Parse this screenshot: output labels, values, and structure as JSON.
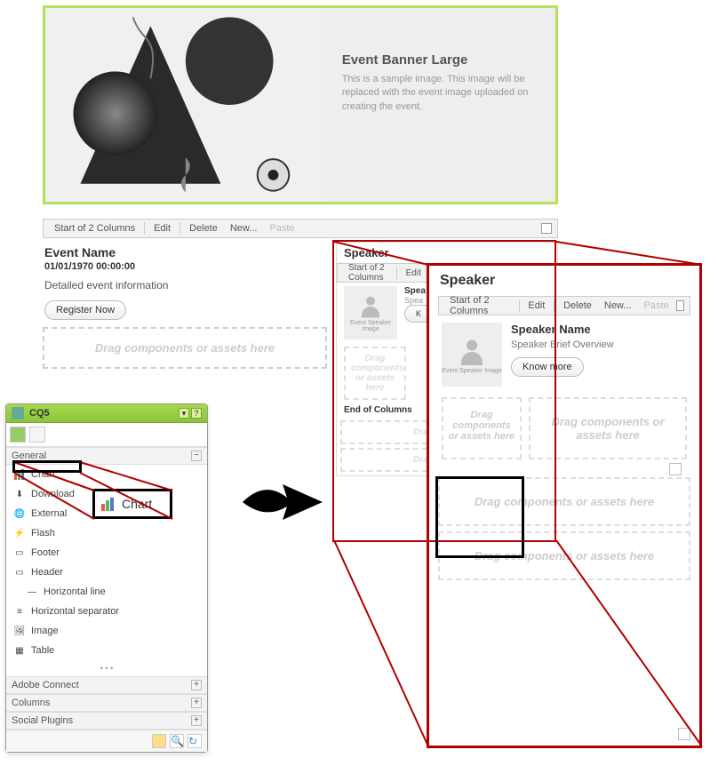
{
  "banner": {
    "title": "Event Banner Large",
    "desc": "This is a sample image. This image will be replaced with the event image uploaded on creating the event."
  },
  "toolbar": {
    "start": "Start of 2 Columns",
    "edit": "Edit",
    "delete": "Delete",
    "new": "New...",
    "paste": "Paste"
  },
  "event": {
    "name": "Event Name",
    "date": "01/01/1970 00:00:00",
    "desc": "Detailed event information",
    "register": "Register Now"
  },
  "dropzone": {
    "text": "Drag components or assets here",
    "short": "Drag components or assets here"
  },
  "speaker": {
    "heading": "Speaker",
    "name": "Speaker Name",
    "brief": "Speaker Brief Overview",
    "know_more": "Know more",
    "img_caption": "Event Speaker Image",
    "end": "End of Columns"
  },
  "palette": {
    "title": "CQ5",
    "groups": {
      "general": "General",
      "adobe_connect": "Adobe Connect",
      "columns": "Columns",
      "social_plugins": "Social Plugins"
    },
    "items": {
      "chart": "Chart",
      "download": "Download",
      "external": "External",
      "flash": "Flash",
      "footer": "Footer",
      "header": "Header",
      "horizontal_line": "Horizontal line",
      "horizontal_separator": "Horizontal separator",
      "image": "Image",
      "table": "Table"
    }
  },
  "chart_bubble": "Chart"
}
